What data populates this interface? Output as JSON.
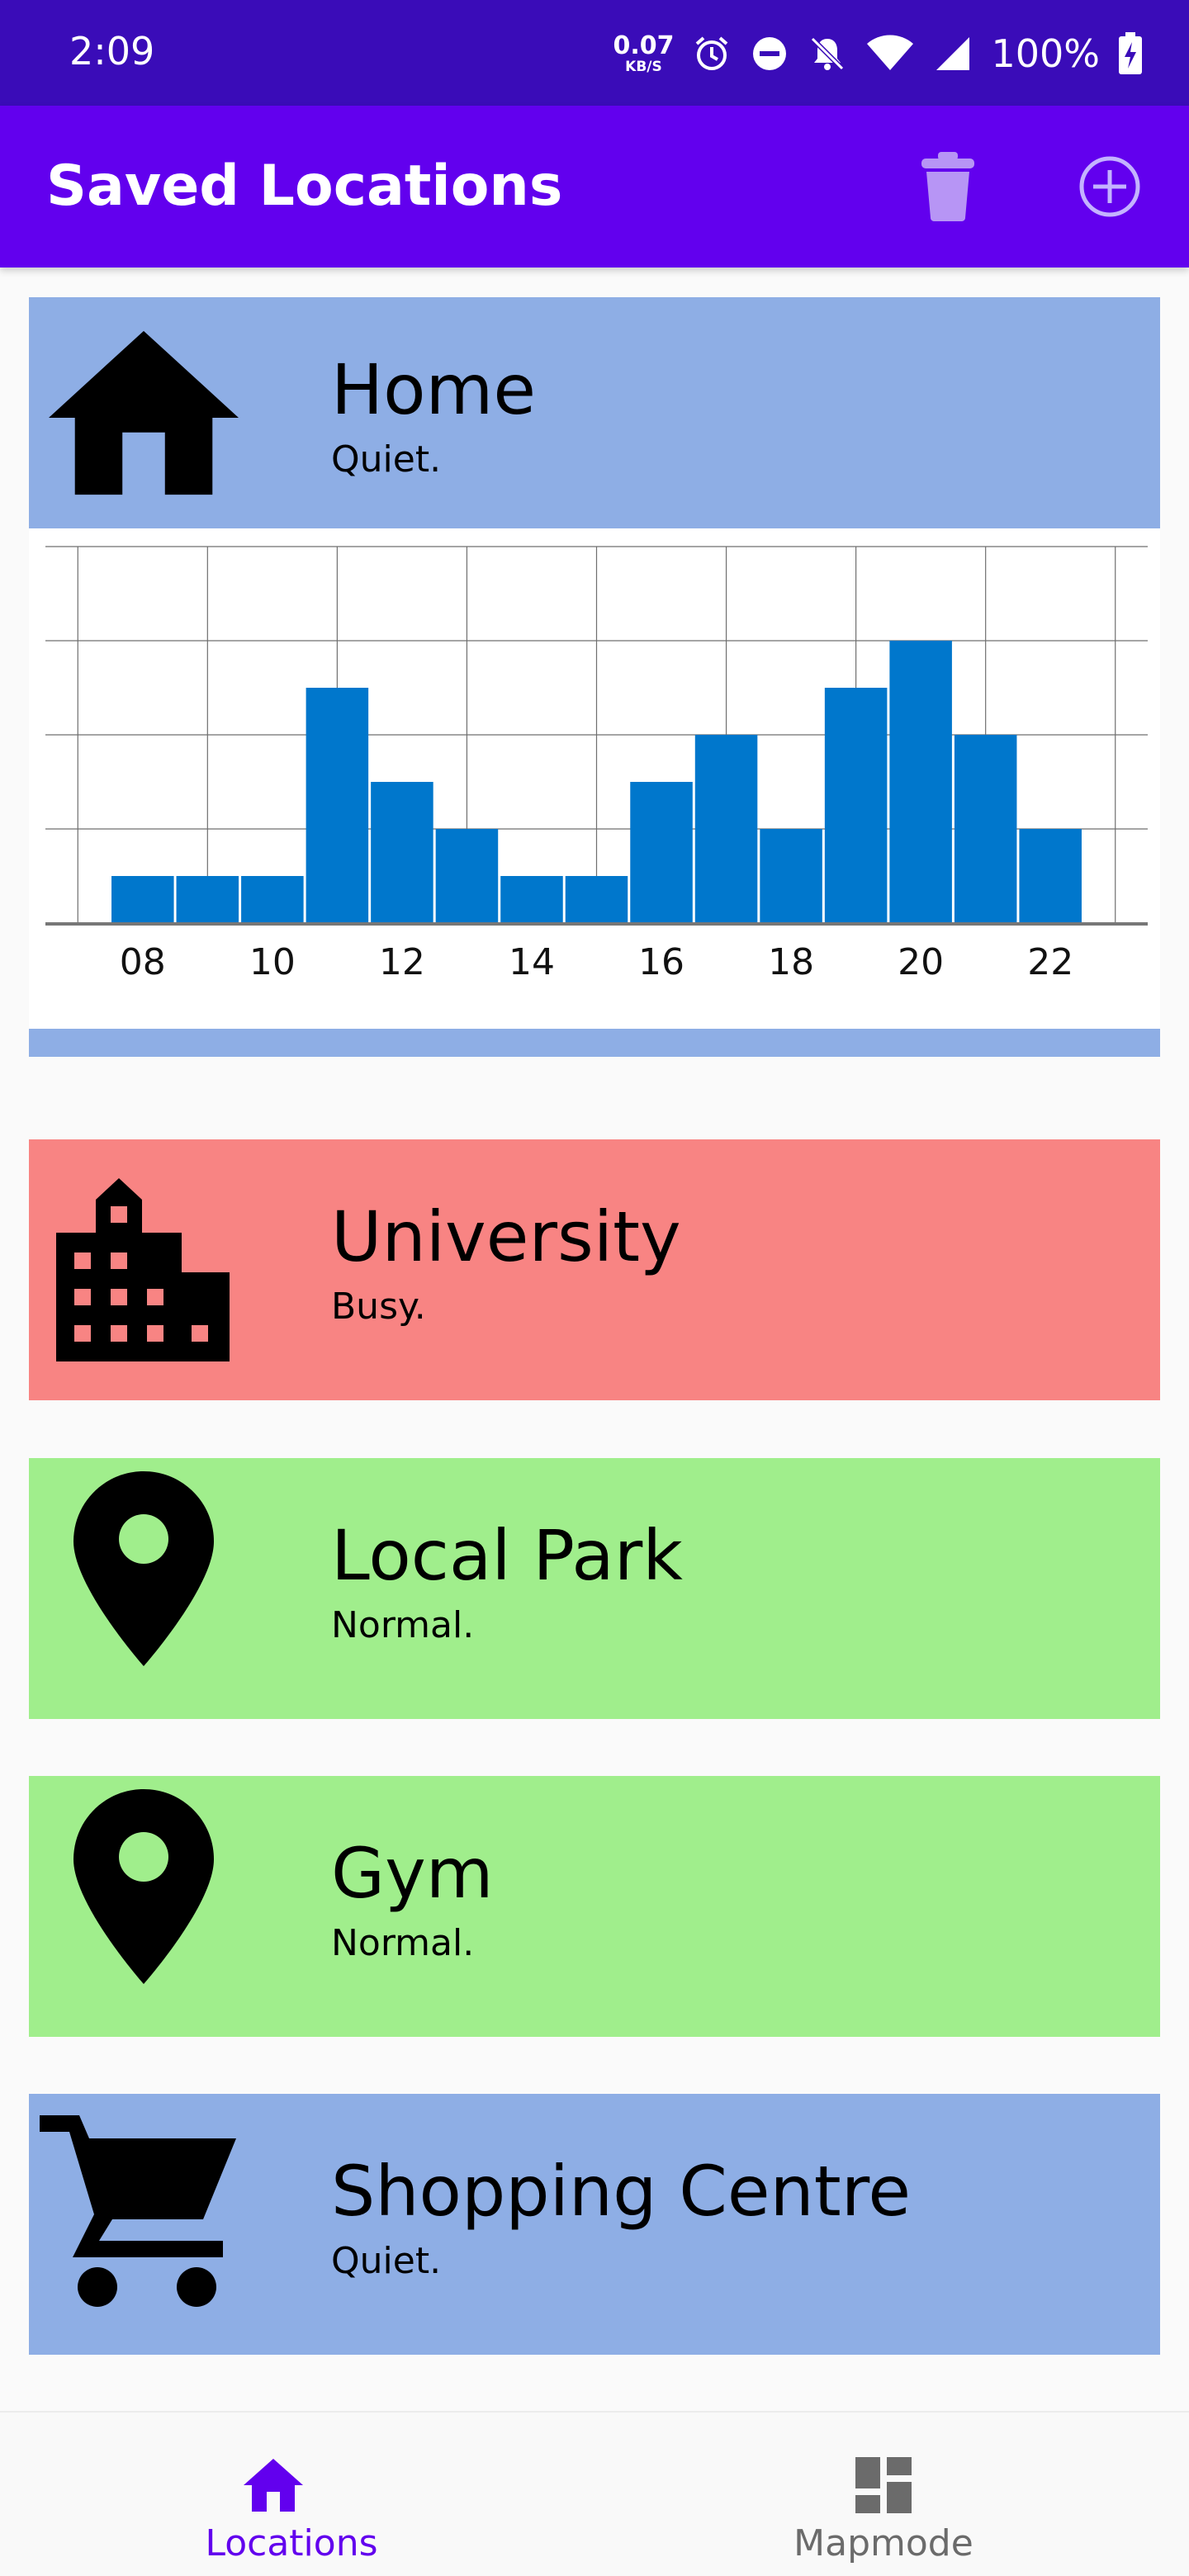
{
  "status_bar": {
    "time": "2:09",
    "net_speed_value": "0.07",
    "net_speed_unit": "KB/S",
    "battery": "100%"
  },
  "app_bar": {
    "title": "Saved Locations"
  },
  "locations": [
    {
      "name": "Home",
      "status": "Quiet.",
      "icon": "home-icon",
      "color": "#8eaee5"
    },
    {
      "name": "University",
      "status": "Busy.",
      "icon": "building-icon",
      "color": "#f88483"
    },
    {
      "name": "Local Park",
      "status": "Normal.",
      "icon": "location-pin-icon",
      "color": "#a0ee8c"
    },
    {
      "name": "Gym",
      "status": "Normal.",
      "icon": "location-pin-icon",
      "color": "#a0ee8c"
    },
    {
      "name": "Shopping Centre",
      "status": "Quiet.",
      "icon": "shopping-cart-icon",
      "color": "#8eaee5"
    }
  ],
  "chart_data": {
    "type": "bar",
    "title": "",
    "xlabel": "",
    "ylabel": "",
    "x": [
      7.5,
      8.5,
      9.5,
      10.5,
      11.5,
      12.5,
      13.5,
      14.5,
      15.5,
      16.5,
      17.5,
      18.5,
      19.5,
      20.5,
      21.5,
      22.5
    ],
    "values": [
      1,
      1,
      1,
      5,
      3,
      2,
      1,
      1,
      3,
      4,
      2,
      5,
      6,
      4,
      2
    ],
    "x_ticks": [
      "08",
      "10",
      "12",
      "14",
      "16",
      "18",
      "20",
      "22"
    ],
    "xlim": [
      6.5,
      23.5
    ],
    "ylim": [
      0,
      8
    ],
    "grid": true,
    "bar_color": "#0077cc"
  },
  "bottom_nav": {
    "items": [
      {
        "label": "Locations",
        "active": true
      },
      {
        "label": "Mapmode",
        "active": false
      }
    ]
  }
}
